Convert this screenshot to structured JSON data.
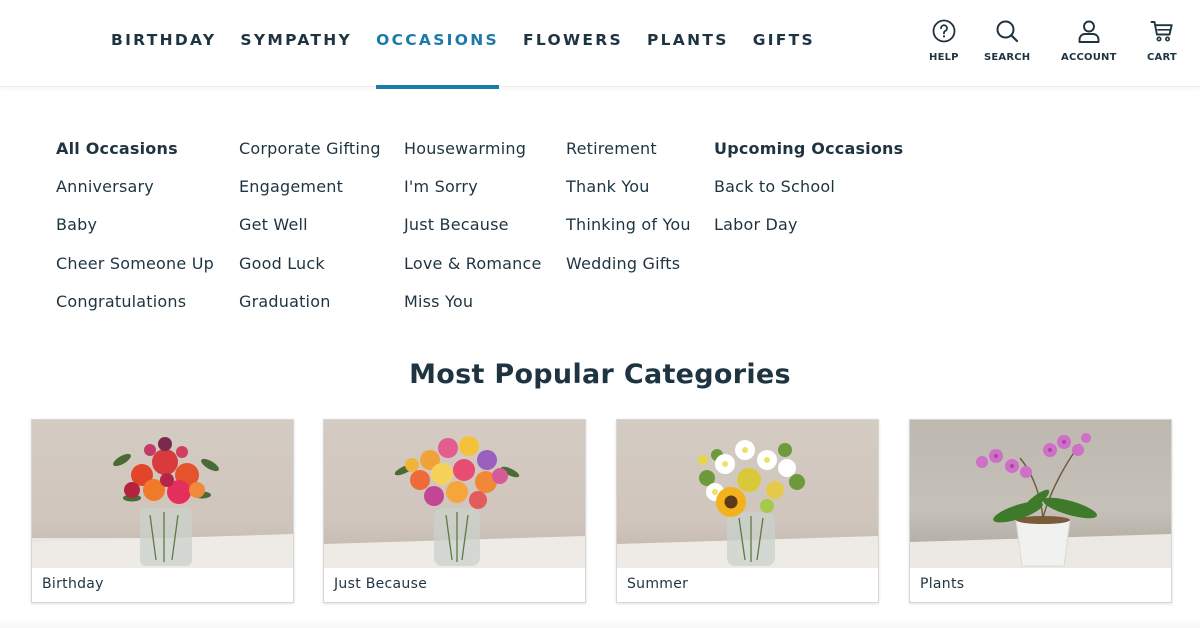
{
  "nav": {
    "items": [
      {
        "label": "BIRTHDAY"
      },
      {
        "label": "SYMPATHY"
      },
      {
        "label": "OCCASIONS",
        "active": true
      },
      {
        "label": "FLOWERS"
      },
      {
        "label": "PLANTS"
      },
      {
        "label": "GIFTS"
      }
    ],
    "active_color": "#1c7aaa",
    "text_color": "#1e3441"
  },
  "utility": {
    "help": {
      "label": "HELP",
      "icon": "help-circle-icon"
    },
    "search": {
      "label": "SEARCH",
      "icon": "search-icon"
    },
    "account": {
      "label": "ACCOUNT",
      "icon": "user-icon"
    },
    "cart": {
      "label": "CART",
      "icon": "cart-icon"
    }
  },
  "menu": {
    "col1": [
      "All Occasions",
      "Anniversary",
      "Baby",
      "Cheer Someone Up",
      "Congratulations"
    ],
    "col2": [
      "Corporate Gifting",
      "Engagement",
      "Get Well",
      "Good Luck",
      "Graduation"
    ],
    "col3": [
      "Housewarming",
      "I'm Sorry",
      "Just Because",
      "Love & Romance",
      "Miss You"
    ],
    "col4": [
      "Retirement",
      "Thank You",
      "Thinking of You",
      "Wedding Gifts"
    ],
    "col5": [
      "Upcoming Occasions",
      "Back to School",
      "Labor Day"
    ]
  },
  "popular": {
    "title": "Most Popular Categories",
    "cards": [
      {
        "label": "Birthday"
      },
      {
        "label": "Just Because"
      },
      {
        "label": "Summer"
      },
      {
        "label": "Plants"
      }
    ]
  }
}
